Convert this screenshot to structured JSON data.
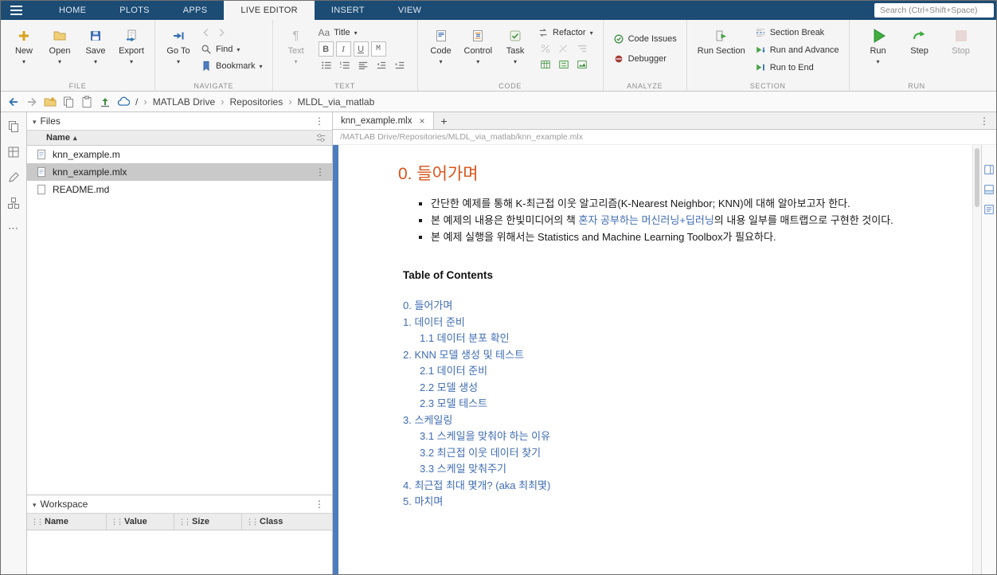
{
  "colors": {
    "topbar_blue": "#1c4c74",
    "accent_blue": "#4d7dbd",
    "heading_orange": "#d95319",
    "link_blue": "#3f6cb3",
    "run_green": "#3fae3f",
    "selected_row_gray": "#c9c9c9"
  },
  "topbar": {
    "tabs": [
      {
        "label": "HOME"
      },
      {
        "label": "PLOTS"
      },
      {
        "label": "APPS"
      },
      {
        "label": "LIVE EDITOR",
        "active": true
      },
      {
        "label": "INSERT"
      },
      {
        "label": "VIEW"
      }
    ],
    "search_placeholder": "Search (Ctrl+Shift+Space)"
  },
  "ribbon": {
    "file": {
      "label": "FILE",
      "new": "New",
      "open": "Open",
      "save": "Save",
      "export": "Export"
    },
    "navigate": {
      "label": "NAVIGATE",
      "goto": "Go To",
      "find": "Find",
      "bookmark": "Bookmark"
    },
    "text": {
      "label": "TEXT",
      "text": "Text",
      "aa": "Aa",
      "title": "Title",
      "bold": "B",
      "italic": "I",
      "underline": "U",
      "mono": "M"
    },
    "code": {
      "label": "CODE",
      "code": "Code",
      "control": "Control",
      "task": "Task",
      "refactor": "Refactor"
    },
    "analyze": {
      "label": "ANALYZE",
      "code_issues": "Code Issues",
      "debugger": "Debugger"
    },
    "section": {
      "label": "SECTION",
      "run_section": "Run Section",
      "section_break": "Section Break",
      "run_and_advance": "Run and Advance",
      "run_to_end": "Run to End"
    },
    "run": {
      "label": "RUN",
      "run": "Run",
      "step": "Step",
      "stop": "Stop"
    }
  },
  "breadcrumb": {
    "items": [
      "/",
      "MATLAB Drive",
      "Repositories",
      "MLDL_via_matlab"
    ]
  },
  "files": {
    "title": "Files",
    "name_col": "Name",
    "items": [
      {
        "name": "knn_example.m",
        "selected": false
      },
      {
        "name": "knn_example.mlx",
        "selected": true
      },
      {
        "name": "README.md",
        "selected": false
      }
    ]
  },
  "workspace": {
    "title": "Workspace",
    "columns": [
      "Name",
      "Value",
      "Size",
      "Class"
    ]
  },
  "editor": {
    "tab_title": "knn_example.mlx",
    "file_path": "/MATLAB Drive/Repositories/MLDL_via_matlab/knn_example.mlx",
    "heading": "0. 들어가며",
    "bullets": {
      "b1": "간단한 예제를 통해 K-최근접 이웃 알고리즘(K-Nearest Neighbor; KNN)에 대해 알아보고자 한다.",
      "b2_pre": "본 예제의 내용은 한빛미디어의 책 ",
      "b2_link": "혼자 공부하는 머신러닝+딥러닝",
      "b2_post": "의 내용 일부를 매트랩으로 구현한 것이다.",
      "b3": "본 예제 실행을 위해서는 Statistics and Machine Learning Toolbox가 필요하다."
    },
    "toc_title": "Table of Contents",
    "toc": [
      {
        "label": "0. 들어가며",
        "level": 0
      },
      {
        "label": "1. 데이터 준비",
        "level": 0
      },
      {
        "label": "1.1 데이터 분포 확인",
        "level": 1
      },
      {
        "label": "2. KNN 모델 생성 및 테스트",
        "level": 0
      },
      {
        "label": "2.1 데이터 준비",
        "level": 1
      },
      {
        "label": "2.2 모델 생성",
        "level": 1
      },
      {
        "label": "2.3 모델 테스트",
        "level": 1
      },
      {
        "label": "3. 스케일링",
        "level": 0
      },
      {
        "label": "3.1 스케일을 맞춰야 하는 이유",
        "level": 1
      },
      {
        "label": "3.2 최근접 이웃 데이터 찾기",
        "level": 1
      },
      {
        "label": "3.3 스케일 맞춰주기",
        "level": 1
      },
      {
        "label": "4. 최근접 최대 몇개? (aka 최최몇)",
        "level": 0
      },
      {
        "label": "5. 마치며",
        "level": 0
      }
    ]
  }
}
